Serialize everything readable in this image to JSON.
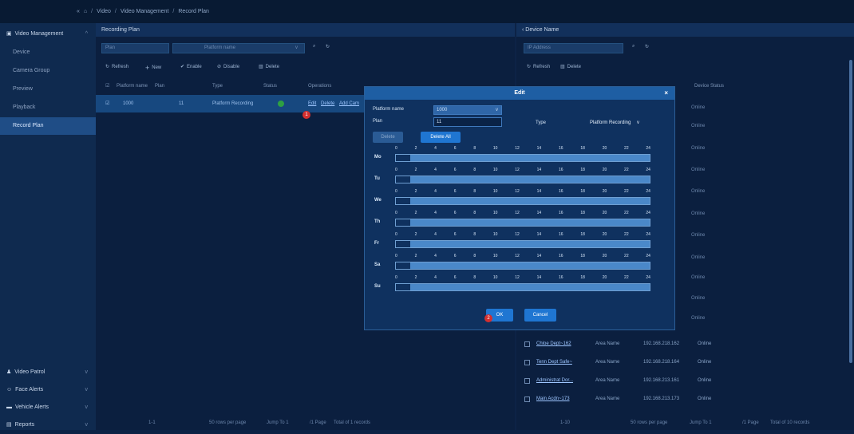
{
  "breadcrumb": {
    "home": "⌂",
    "items": [
      "Video",
      "Video Management",
      "Record Plan"
    ],
    "sep": "/"
  },
  "sidebar": {
    "sections": [
      {
        "label": "Video Management",
        "icon": "video-icon",
        "items": [
          "Device",
          "Camera Group",
          "Preview",
          "Playback",
          "Record Plan"
        ],
        "active": "Record Plan"
      }
    ],
    "bottom": [
      {
        "label": "Video Patrol",
        "icon": "patrol-icon"
      },
      {
        "label": "Face Alerts",
        "icon": "face-icon"
      },
      {
        "label": "Vehicle Alerts",
        "icon": "vehicle-icon"
      },
      {
        "label": "Reports",
        "icon": "report-icon"
      }
    ]
  },
  "left": {
    "title": "Recording Plan",
    "plan_placeholder": "Plan",
    "platform_placeholder": "Platform name",
    "toolbar": {
      "refresh": "Refresh",
      "new": "New",
      "enable": "Enable",
      "disable": "Disable",
      "delete": "Delete"
    },
    "columns": [
      "Platform name",
      "Plan",
      "Type",
      "Status",
      "Operations"
    ],
    "row": {
      "platform": "1000",
      "plan": "11",
      "type": "Platform Recording",
      "ops": [
        "Edit",
        "Delete",
        "Add Cam"
      ]
    },
    "footer": {
      "range": "1-1",
      "rows": "50 rows per page",
      "jump": "Jump To 1",
      "pages": "/1 Page",
      "total": "Total of 1 records"
    }
  },
  "right": {
    "title": "Device Name",
    "ip_placeholder": "IP Address",
    "toolbar": {
      "refresh": "Refresh",
      "delete": "Delete"
    },
    "status_col": "Device Status",
    "status_values": [
      "Online",
      "Online",
      "Online",
      "Online",
      "Online",
      "Online",
      "Online",
      "Online",
      "Online",
      "Online",
      "Online",
      "Online",
      "Online",
      "Online"
    ],
    "rows": [
      {
        "name": "Chloe Dept~162",
        "area": "Area Name",
        "ip": "192.168.218.162",
        "status": "Online"
      },
      {
        "name": "Tenn Dept Safe~",
        "area": "Area Name",
        "ip": "192.168.218.164",
        "status": "Online"
      },
      {
        "name": "Administrat Dor...",
        "area": "Area Name",
        "ip": "192.168.213.161",
        "status": "Online"
      },
      {
        "name": "Main Acdn~173",
        "area": "Area Name",
        "ip": "192.168.213.173",
        "status": "Online"
      }
    ],
    "footer": {
      "range": "1-10",
      "rows": "50 rows per page",
      "jump": "Jump To 1",
      "pages": "/1 Page",
      "total": "Total of 10 records"
    }
  },
  "dialog": {
    "title": "Edit",
    "platform_label": "Platform name",
    "platform_value": "1000",
    "plan_label": "Plan",
    "plan_value": "11",
    "type_label": "Type",
    "type_value": "Platform Recording",
    "delete_label": "Delete",
    "delete_all_label": "Delete All",
    "hours": [
      "0",
      "2",
      "4",
      "6",
      "8",
      "10",
      "12",
      "14",
      "16",
      "18",
      "20",
      "22",
      "24"
    ],
    "days": [
      "Mo",
      "Tu",
      "We",
      "Th",
      "Fr",
      "Sa",
      "Su"
    ],
    "ok": "OK",
    "cancel": "Cancel"
  },
  "badges": [
    "1",
    "2"
  ]
}
